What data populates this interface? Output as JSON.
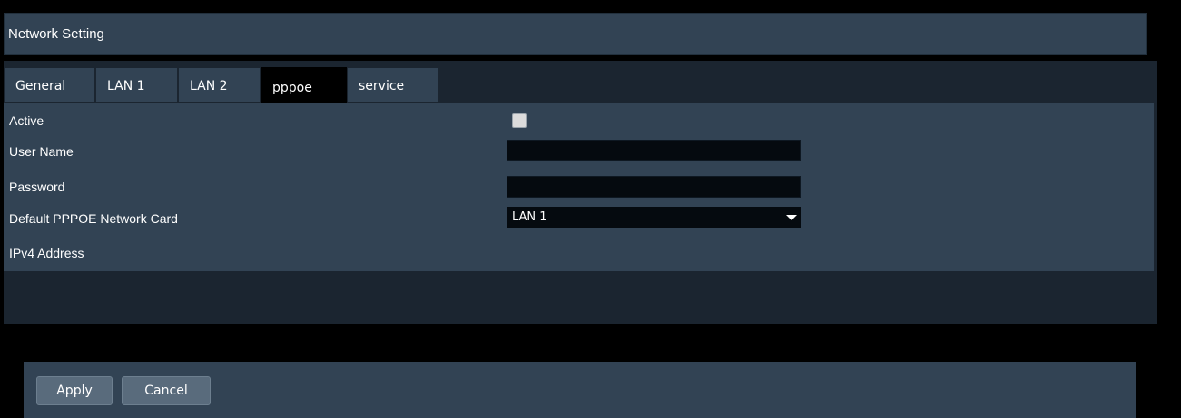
{
  "window": {
    "title": "Network Setting"
  },
  "tabs": [
    {
      "label": "General",
      "active": false
    },
    {
      "label": "LAN 1",
      "active": false
    },
    {
      "label": "LAN 2",
      "active": false
    },
    {
      "label": "pppoe",
      "active": true
    },
    {
      "label": "service",
      "active": false
    }
  ],
  "form": {
    "active": {
      "label": "Active",
      "checked": false
    },
    "user_name": {
      "label": "User Name",
      "value": ""
    },
    "password": {
      "label": "Password",
      "value": ""
    },
    "network_card": {
      "label": "Default PPPOE Network Card",
      "selected": "LAN 1"
    },
    "ipv4": {
      "label": "IPv4 Address",
      "value": ""
    }
  },
  "actions": {
    "apply_label": "Apply",
    "cancel_label": "Cancel"
  },
  "colors": {
    "panel": "#324354",
    "panel_dark": "#1b2530",
    "background": "#000000",
    "input_bg": "#050a0f",
    "button": "#596b7c"
  }
}
